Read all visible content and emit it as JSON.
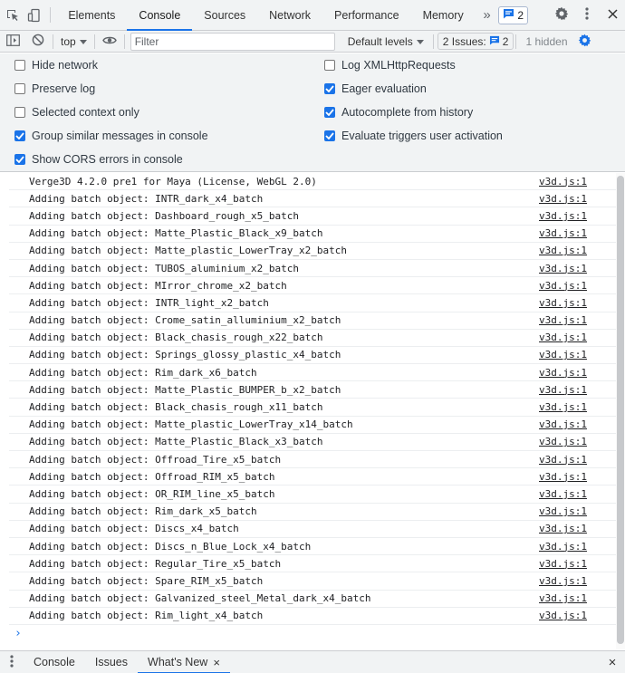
{
  "topbar": {
    "tabs": [
      "Elements",
      "Console",
      "Sources",
      "Network",
      "Performance",
      "Memory"
    ],
    "more_label": "»",
    "issues_badge_count": "2"
  },
  "console_toolbar": {
    "context": "top",
    "filter_placeholder": "Filter",
    "levels": "Default levels",
    "issues_label": "2 Issues:",
    "issues_count": "2",
    "hidden_label": "1 hidden"
  },
  "settings": {
    "left": [
      {
        "label": "Hide network",
        "checked": false
      },
      {
        "label": "Preserve log",
        "checked": false
      },
      {
        "label": "Selected context only",
        "checked": false
      },
      {
        "label": "Group similar messages in console",
        "checked": true
      },
      {
        "label": "Show CORS errors in console",
        "checked": true
      }
    ],
    "right": [
      {
        "label": "Log XMLHttpRequests",
        "checked": false
      },
      {
        "label": "Eager evaluation",
        "checked": true
      },
      {
        "label": "Autocomplete from history",
        "checked": true
      },
      {
        "label": "Evaluate triggers user activation",
        "checked": true
      }
    ]
  },
  "messages": [
    {
      "text": "Verge3D 4.2.0 pre1 for Maya (License, WebGL 2.0)",
      "source": "v3d.js:1"
    },
    {
      "text": "Adding batch object: INTR_dark_x4_batch",
      "source": "v3d.js:1"
    },
    {
      "text": "Adding batch object: Dashboard_rough_x5_batch",
      "source": "v3d.js:1"
    },
    {
      "text": "Adding batch object: Matte_Plastic_Black_x9_batch",
      "source": "v3d.js:1"
    },
    {
      "text": "Adding batch object: Matte_plastic_LowerTray_x2_batch",
      "source": "v3d.js:1"
    },
    {
      "text": "Adding batch object: TUBOS_aluminium_x2_batch",
      "source": "v3d.js:1"
    },
    {
      "text": "Adding batch object: MIrror_chrome_x2_batch",
      "source": "v3d.js:1"
    },
    {
      "text": "Adding batch object: INTR_light_x2_batch",
      "source": "v3d.js:1"
    },
    {
      "text": "Adding batch object: Crome_satin_alluminium_x2_batch",
      "source": "v3d.js:1"
    },
    {
      "text": "Adding batch object: Black_chasis_rough_x22_batch",
      "source": "v3d.js:1"
    },
    {
      "text": "Adding batch object: Springs_glossy_plastic_x4_batch",
      "source": "v3d.js:1"
    },
    {
      "text": "Adding batch object: Rim_dark_x6_batch",
      "source": "v3d.js:1"
    },
    {
      "text": "Adding batch object: Matte_Plastic_BUMPER_b_x2_batch",
      "source": "v3d.js:1"
    },
    {
      "text": "Adding batch object: Black_chasis_rough_x11_batch",
      "source": "v3d.js:1"
    },
    {
      "text": "Adding batch object: Matte_plastic_LowerTray_x14_batch",
      "source": "v3d.js:1"
    },
    {
      "text": "Adding batch object: Matte_Plastic_Black_x3_batch",
      "source": "v3d.js:1"
    },
    {
      "text": "Adding batch object: Offroad_Tire_x5_batch",
      "source": "v3d.js:1"
    },
    {
      "text": "Adding batch object: Offroad_RIM_x5_batch",
      "source": "v3d.js:1"
    },
    {
      "text": "Adding batch object: OR_RIM_line_x5_batch",
      "source": "v3d.js:1"
    },
    {
      "text": "Adding batch object: Rim_dark_x5_batch",
      "source": "v3d.js:1"
    },
    {
      "text": "Adding batch object: Discs_x4_batch",
      "source": "v3d.js:1"
    },
    {
      "text": "Adding batch object: Discs_n_Blue_Lock_x4_batch",
      "source": "v3d.js:1"
    },
    {
      "text": "Adding batch object: Regular_Tire_x5_batch",
      "source": "v3d.js:1"
    },
    {
      "text": "Adding batch object: Spare_RIM_x5_batch",
      "source": "v3d.js:1"
    },
    {
      "text": "Adding batch object: Galvanized_steel_Metal_dark_x4_batch",
      "source": "v3d.js:1"
    },
    {
      "text": "Adding batch object: Rim_light_x4_batch",
      "source": "v3d.js:1"
    }
  ],
  "prompt_symbol": "›",
  "drawer": {
    "tabs": [
      "Console",
      "Issues",
      "What's New"
    ],
    "close_tab_symbol": "×",
    "close_symbol": "×"
  },
  "colors": {
    "accent": "#1a73e8",
    "toolbar_bg": "#f1f3f4"
  }
}
